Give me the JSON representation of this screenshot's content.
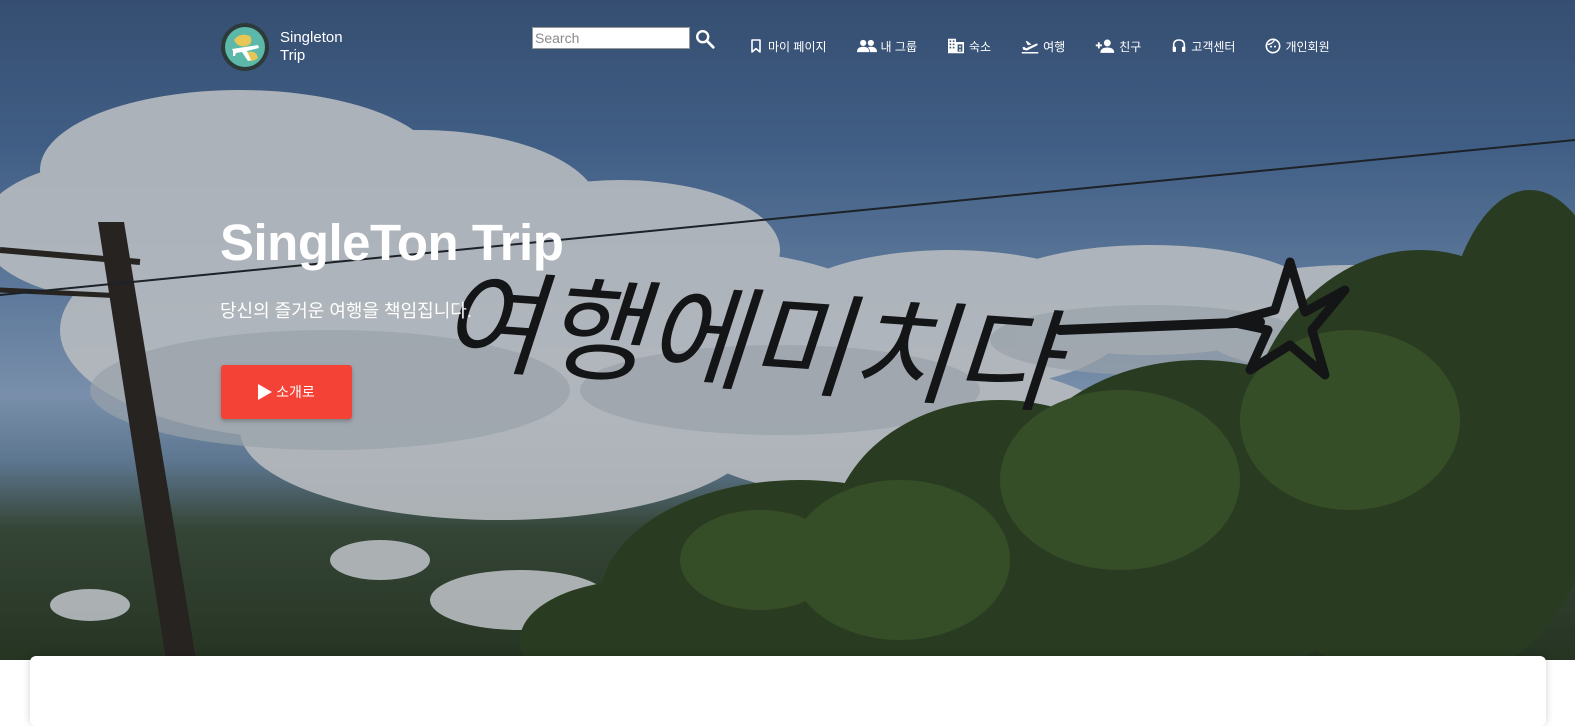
{
  "brand": {
    "name_line1": "Singleton",
    "name_line2": "Trip"
  },
  "search": {
    "placeholder": "Search",
    "value": ""
  },
  "nav": [
    {
      "label": "마이 페이지",
      "icon": "bookmark-icon"
    },
    {
      "label": "내 그룹",
      "icon": "group-icon"
    },
    {
      "label": "숙소",
      "icon": "building-icon"
    },
    {
      "label": "여행",
      "icon": "flight-takeoff-icon"
    },
    {
      "label": "친구",
      "icon": "person-add-icon"
    },
    {
      "label": "고객센터",
      "icon": "headset-icon"
    },
    {
      "label": "개인회원",
      "icon": "face-icon"
    }
  ],
  "hero": {
    "title": "SingleTon Trip",
    "subtitle": "당신의 즐거운 여행을 책임집니다.",
    "button_label": "소개로",
    "overlay_text": "여행에미치다"
  },
  "colors": {
    "accent": "#f44336",
    "nav_text": "#ffffff"
  }
}
